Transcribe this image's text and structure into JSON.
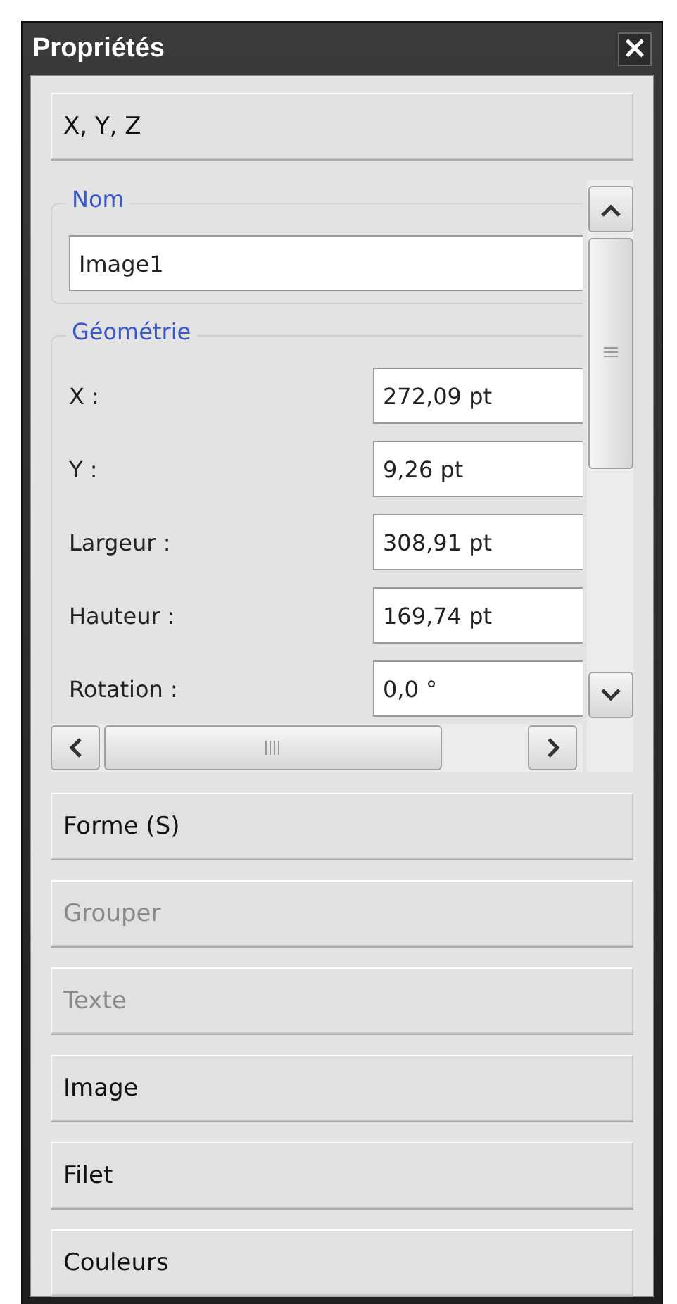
{
  "window": {
    "title": "Propriétés",
    "close": "×"
  },
  "top_sections": [
    {
      "label": "X, Y, Z",
      "disabled": false
    }
  ],
  "groups": [
    {
      "title": "Nom",
      "fields": [
        {
          "value": "Image1"
        }
      ]
    },
    {
      "title": "Géométrie",
      "fields": [
        {
          "label": "X :",
          "value": "272,09 pt"
        },
        {
          "label": "Y :",
          "value": "9,26 pt"
        },
        {
          "label": "Largeur :",
          "value": "308,91 pt"
        },
        {
          "label": "Hauteur :",
          "value": "169,74 pt"
        },
        {
          "label": "Rotation :",
          "value": "0,0 °"
        }
      ]
    }
  ],
  "bottom_sections": [
    {
      "label": "Forme (S)",
      "disabled": false
    },
    {
      "label": "Grouper",
      "disabled": true
    },
    {
      "label": "Texte",
      "disabled": true
    },
    {
      "label": "Image",
      "disabled": false
    },
    {
      "label": "Filet",
      "disabled": false
    },
    {
      "label": "Couleurs",
      "disabled": false
    }
  ]
}
